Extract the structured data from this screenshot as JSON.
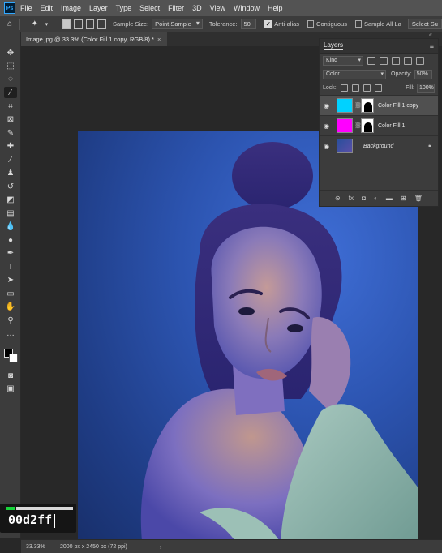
{
  "app": {
    "logo": "Ps"
  },
  "menu": [
    "File",
    "Edit",
    "Image",
    "Layer",
    "Type",
    "Select",
    "Filter",
    "3D",
    "View",
    "Window",
    "Help"
  ],
  "options": {
    "home_icon": "home-icon",
    "sample_size_label": "Sample Size:",
    "sample_size_value": "Point Sample",
    "tolerance_label": "Tolerance:",
    "tolerance_value": "50",
    "anti_alias_label": "Anti-alias",
    "anti_alias_checked": true,
    "contiguous_label": "Contiguous",
    "contiguous_checked": false,
    "sample_all_label": "Sample All La",
    "sample_all_checked": false,
    "select_subject_label": "Select Su"
  },
  "document": {
    "tab_title": "Image.jpg @ 33.3% (Color Fill 1 copy, RGB/8) *",
    "close_glyph": "×"
  },
  "layers_panel": {
    "title": "Layers",
    "filter_kind": "Kind",
    "blend_mode": "Color",
    "opacity_label": "Opacity:",
    "opacity_value": "50%",
    "lock_label": "Lock:",
    "fill_label": "Fill:",
    "fill_value": "100%",
    "layers": [
      {
        "name": "Color Fill 1 copy",
        "color": "#00d2ff",
        "selected": true
      },
      {
        "name": "Color Fill 1",
        "color": "#ff00ff",
        "selected": false
      },
      {
        "name": "Background",
        "color": "#2a4f9c",
        "selected": false,
        "locked": true
      }
    ]
  },
  "hex_overlay": {
    "value": "00d2ff"
  },
  "status": {
    "zoom": "33.33%",
    "doc_info": "2000 px x 2450 px (72 ppi)",
    "arrow": "›"
  },
  "colors": {
    "accent_cyan": "#00d2ff",
    "accent_magenta": "#ff00ff",
    "foreground": "#000000",
    "background": "#ffffff"
  }
}
